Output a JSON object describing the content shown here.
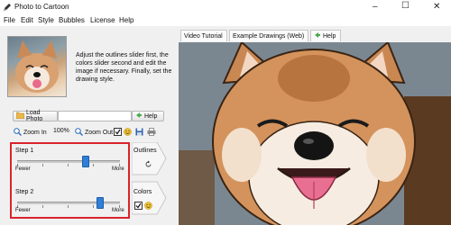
{
  "window": {
    "title": "Photo to Cartoon"
  },
  "menu": [
    "File",
    "Edit",
    "Style",
    "Bubbles",
    "License",
    "Help"
  ],
  "instructions": "Adjust the outlines slider first, the colors slider second and edit the image if necessary. Finally, set the drawing style.",
  "load_photo": {
    "label": "Load Photo",
    "path_value": ""
  },
  "help_label": "Help",
  "toolbar": {
    "zoom_in": "Zoom In",
    "zoom_level": "100%",
    "zoom_out": "Zoom Out"
  },
  "step1": {
    "label": "Step 1",
    "min_label": "Fewer",
    "max_label": "More",
    "side_label": "Outlines",
    "value": 0.66
  },
  "step2": {
    "label": "Step 2",
    "min_label": "Fewer",
    "max_label": "More",
    "side_label": "Colors",
    "value": 0.8
  },
  "tabs": [
    "Video Tutorial",
    "Example Drawings (Web)",
    "Help"
  ],
  "colors": {
    "highlight_border": "#d9232a",
    "slider_thumb": "#2f7fd8"
  }
}
